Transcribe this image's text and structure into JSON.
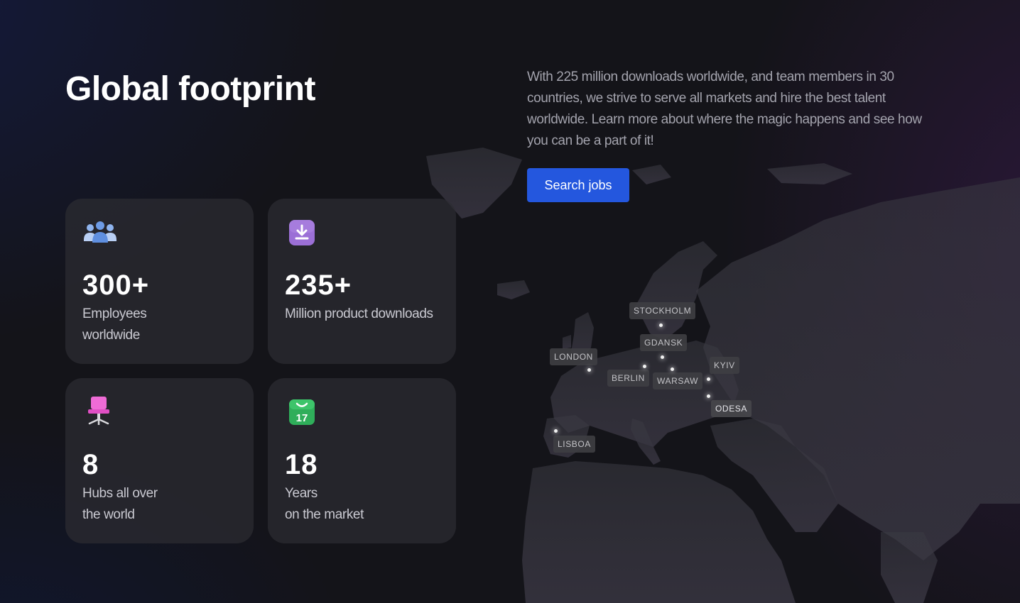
{
  "header": {
    "title": "Global footprint",
    "description": "With 225 million downloads worldwide, and team members in 30 countries, we strive to serve all markets and hire the best talent worldwide. Learn more about where the magic happens and see how you can be a part of it!",
    "search_button": "Search jobs"
  },
  "stats": [
    {
      "icon": "people-group-icon",
      "value": "300+",
      "label_lines": [
        "Employees",
        "worldwide"
      ]
    },
    {
      "icon": "download-icon",
      "value": "235+",
      "label_lines": [
        "Million product downloads"
      ]
    },
    {
      "icon": "office-chair-icon",
      "value": "8",
      "label_lines": [
        "Hubs all over",
        "the world"
      ]
    },
    {
      "icon": "calendar-icon",
      "value": "18",
      "label_lines": [
        "Years",
        "on the market"
      ],
      "icon_text": "17"
    }
  ],
  "cities": [
    "STOCKHOLM",
    "GDANSK",
    "LONDON",
    "BERLIN",
    "WARSAW",
    "KYIV",
    "ODESA",
    "LISBOA"
  ],
  "colors": {
    "accent": "#2457de",
    "card_bg": "#2c2c32",
    "text_muted": "#a3a3ad",
    "icon_purple": "#9b6fd6",
    "icon_green": "#2fae5a",
    "icon_pink": "#ef6bd6"
  }
}
